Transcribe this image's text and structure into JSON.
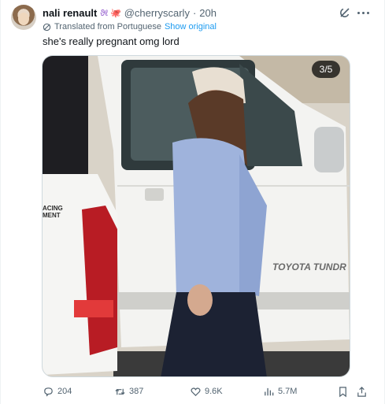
{
  "tweet": {
    "display_name": "nali renault",
    "name_emoji": "ϑℓ 🐙",
    "handle": "@cherryscarly",
    "separator": "·",
    "time": "20h",
    "translated_label": "Translated from Portuguese",
    "show_original_label": "Show original",
    "text": "she's really pregnant omg lord"
  },
  "media": {
    "counter": "3/5",
    "truck_text_left": "ACING\nMENT",
    "truck_badge": "TOYOTA TUNDRA",
    "truck_badge_display": "TOYOTA TUNDR"
  },
  "actions": {
    "replies": "204",
    "retweets": "387",
    "likes": "9.6K",
    "views": "5.7M"
  },
  "icons": {
    "grok": "grok-icon",
    "more": "more-icon",
    "translate": "translate-icon",
    "reply": "reply-icon",
    "retweet": "retweet-icon",
    "like": "heart-icon",
    "views": "views-icon",
    "bookmark": "bookmark-icon",
    "share": "share-icon"
  },
  "colors": {
    "text_primary": "#0f1419",
    "text_secondary": "#536471",
    "link": "#1d9bf0"
  }
}
